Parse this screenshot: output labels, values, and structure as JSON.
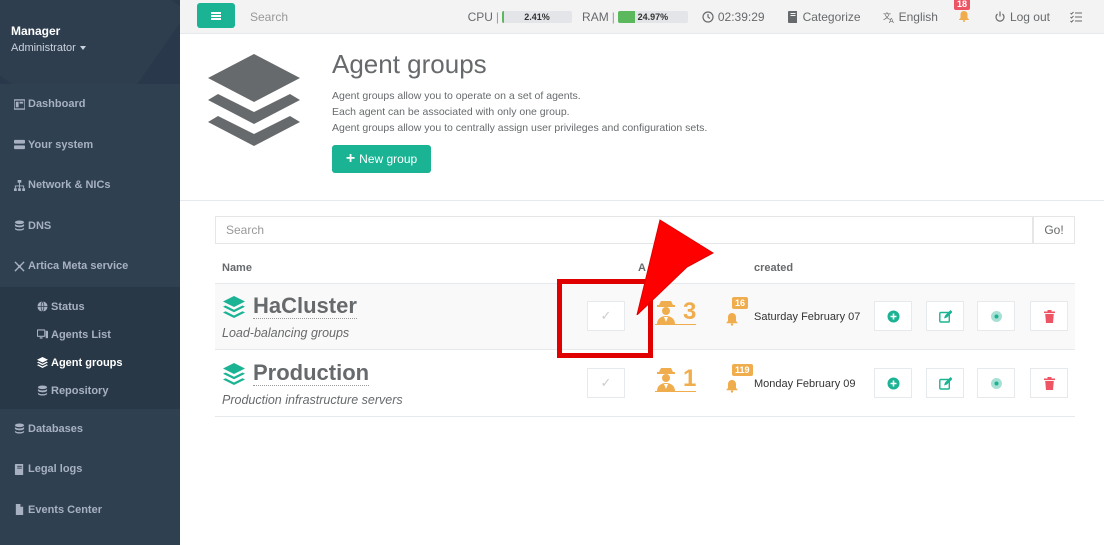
{
  "sidebar": {
    "user": "Manager",
    "role": "Administrator",
    "items": [
      {
        "label": "Dashboard",
        "icon": "dashboard-icon"
      },
      {
        "label": "Your system",
        "icon": "server-icon"
      },
      {
        "label": "Network & NICs",
        "icon": "network-icon"
      },
      {
        "label": "DNS",
        "icon": "database-icon"
      },
      {
        "label": "Artica Meta service",
        "icon": "meta-icon"
      }
    ],
    "subitems": [
      {
        "label": "Status",
        "icon": "globe-icon"
      },
      {
        "label": "Agents List",
        "icon": "monitor-icon"
      },
      {
        "label": "Agent groups",
        "icon": "layers-icon",
        "active": true
      },
      {
        "label": "Repository",
        "icon": "database-icon"
      }
    ],
    "bottom_items": [
      {
        "label": "Databases",
        "icon": "database-icon"
      },
      {
        "label": "Legal logs",
        "icon": "book-icon"
      },
      {
        "label": "Events Center",
        "icon": "file-icon"
      }
    ]
  },
  "topbar": {
    "search_placeholder": "Search",
    "cpu_label": "CPU",
    "cpu_value": "2.41%",
    "cpu_fraction": 0.0241,
    "ram_label": "RAM",
    "ram_value": "24.97%",
    "ram_fraction": 0.2497,
    "time": "02:39:29",
    "categorize": "Categorize",
    "language": "English",
    "notifications": "18",
    "logout": "Log out"
  },
  "header": {
    "title": "Agent groups",
    "desc": [
      "Agent groups allow you to operate on a set of agents.",
      "Each agent can be associated with only one group.",
      "Agent groups allow you to centrally assign user privileges and configuration sets."
    ],
    "new_group": "New group"
  },
  "table": {
    "search_placeholder": "Search",
    "go_label": "Go!",
    "headers": {
      "name": "Name",
      "agents": "A",
      "created": "created"
    },
    "rows": [
      {
        "name": "HaCluster",
        "desc": "Load-balancing groups",
        "agents": "3",
        "alerts": "16",
        "created": "Saturday February 07"
      },
      {
        "name": "Production",
        "desc": "Production infrastructure servers",
        "agents": "1",
        "alerts": "119",
        "created": "Monday February 09"
      }
    ]
  },
  "colors": {
    "sidebar": "#2f4050",
    "accent": "#1ab394",
    "warning": "#f0ad4e",
    "danger": "#ed5565",
    "annotation": "#e00000"
  }
}
